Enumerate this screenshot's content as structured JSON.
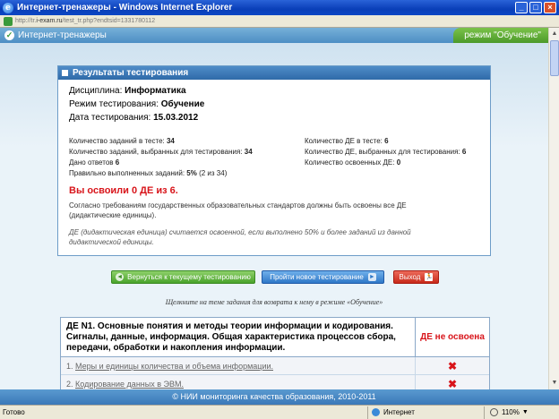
{
  "window": {
    "title": "Интернет-тренажеры - Windows Internet Explorer"
  },
  "address": {
    "prefix": "http://tr.",
    "host": "i-exam.ru",
    "path": "/test_tr.php?endtsid=1331780112"
  },
  "app": {
    "title": "Интернет-тренажеры",
    "mode": "режим \"Обучение\""
  },
  "results": {
    "header": "Результаты тестирования",
    "discipline_label": "Дисциплина:",
    "discipline": "Информатика",
    "mode_label": "Режим тестирования:",
    "mode": "Обучение",
    "date_label": "Дата тестирования:",
    "date": "15.03.2012",
    "stats": {
      "tasks_in_test_label": "Количество заданий в тесте:",
      "tasks_in_test": "34",
      "de_in_test_label": "Количество ДЕ в тесте:",
      "de_in_test": "6",
      "tasks_selected_label": "Количество заданий, выбранных для тестирования:",
      "tasks_selected": "34",
      "de_selected_label": "Количество ДЕ, выбранных для тестирования:",
      "de_selected": "6",
      "answers_label": "Дано ответов",
      "answers": "6",
      "de_mastered_label": "Количество освоенных ДЕ:",
      "de_mastered": "0",
      "correct_label": "Правильно выполненных заданий:",
      "correct_pct": "5%",
      "correct_detail": "(2 из 34)"
    },
    "mastered_summary": "Вы освоили 0 ДЕ из 6.",
    "note": "Согласно требованиям государственных образовательных стандартов должны быть освоены все ДЕ (дидактические единицы).",
    "note2": "ДЕ (дидактическая единица) считается освоенной, если выполнено 50% и более заданий из данной дидактической единицы."
  },
  "buttons": {
    "return": "Вернуться к текущему тестированию",
    "new_test": "Пройти новое тестирование",
    "exit": "Выход"
  },
  "hint": "Щелкните на теме задания для возврата к нему в режиме «Обучение»",
  "de_table": {
    "title": "ДЕ N1. Основные понятия и методы теории информации и кодирования. Сигналы, данные, информация. Общая характеристика процессов сбора, передачи, обработки и накопления информации.",
    "status": "ДЕ не освоена",
    "rows": [
      {
        "num": "1.",
        "topic": "Меры и единицы количества и объема информации."
      },
      {
        "num": "2.",
        "topic": "Кодирование данных в ЭВМ."
      }
    ]
  },
  "footer": "© НИИ мониторинга качества образования, 2010-2011",
  "statusbar": {
    "ready": "Готово",
    "zone": "Интернет",
    "zoom": "110%"
  }
}
